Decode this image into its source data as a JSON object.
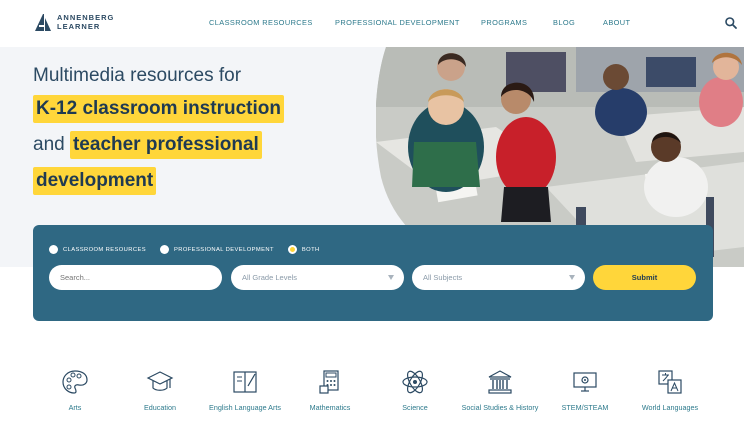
{
  "brand": {
    "line1": "ANNENBERG",
    "line2": "LEARNER"
  },
  "nav": {
    "items": [
      "CLASSROOM RESOURCES",
      "PROFESSIONAL DEVELOPMENT",
      "PROGRAMS",
      "BLOG",
      "ABOUT"
    ]
  },
  "hero": {
    "line1": "Multimedia resources for",
    "highlight1": "K-12 classroom instruction",
    "and": "and ",
    "highlight2": "teacher professional",
    "highlight3": "development"
  },
  "search": {
    "radios": [
      {
        "label": "CLASSROOM RESOURCES",
        "checked": false
      },
      {
        "label": "PROFESSIONAL DEVELOPMENT",
        "checked": false
      },
      {
        "label": "BOTH",
        "checked": true
      }
    ],
    "search_placeholder": "Search...",
    "grade_value": "All Grade Levels",
    "subject_value": "All Subjects",
    "submit_label": "Submit"
  },
  "subjects": [
    {
      "label": "Arts",
      "icon": "palette-icon"
    },
    {
      "label": "Education",
      "icon": "graduation-cap-icon"
    },
    {
      "label": "English Language Arts",
      "icon": "open-book-icon"
    },
    {
      "label": "Mathematics",
      "icon": "calculator-icon"
    },
    {
      "label": "Science",
      "icon": "atom-icon"
    },
    {
      "label": "Social Studies & History",
      "icon": "building-columns-icon"
    },
    {
      "label": "STEM/STEAM",
      "icon": "monitor-gear-icon"
    },
    {
      "label": "World Languages",
      "icon": "translate-icon"
    }
  ],
  "colors": {
    "accent": "#ffd63a",
    "panel": "#2f6883",
    "nav_text": "#2d7a8c",
    "heading": "#2c4a63"
  }
}
